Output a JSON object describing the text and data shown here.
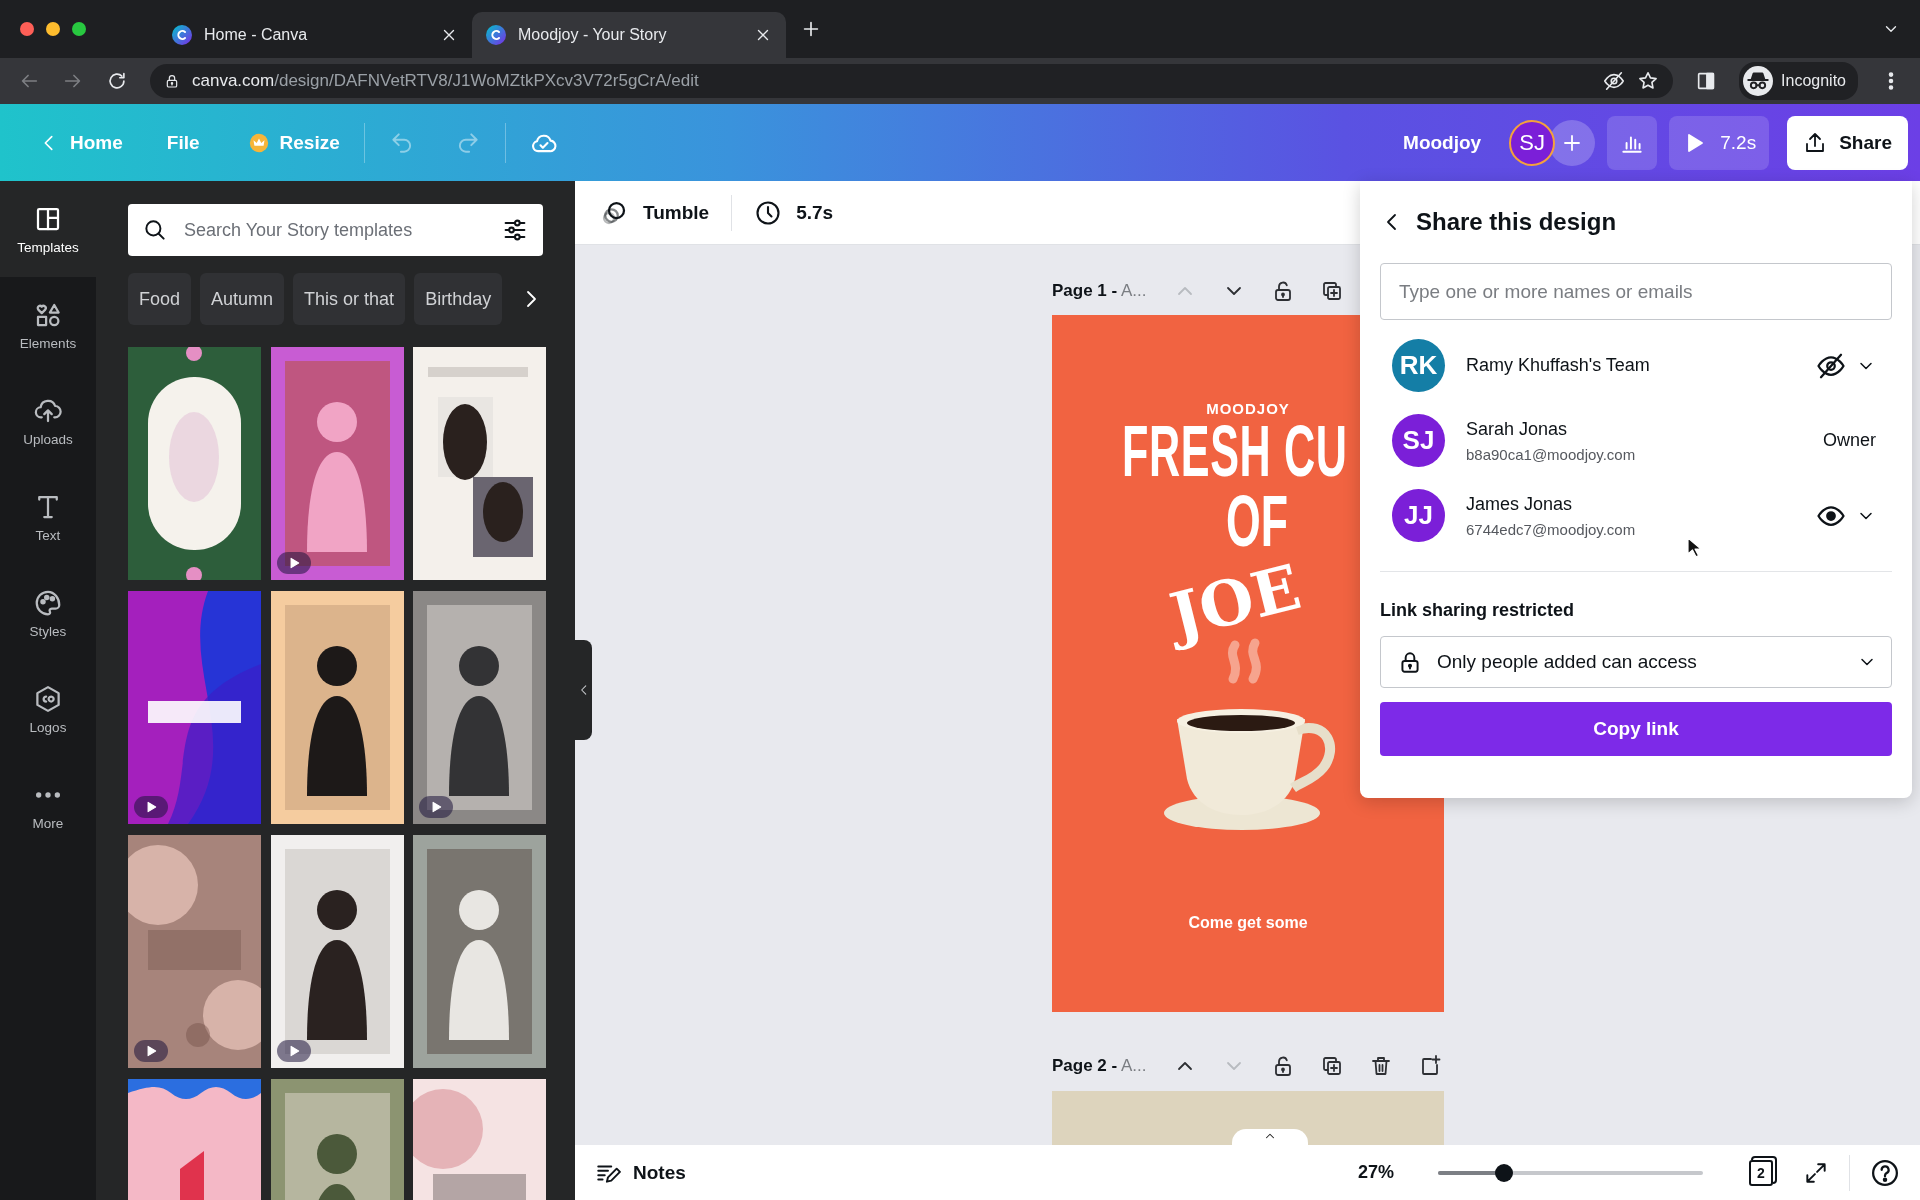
{
  "browser": {
    "tabs": [
      {
        "title": "Home - Canva",
        "selected": false
      },
      {
        "title": "Moodjoy - Your Story",
        "selected": true
      }
    ],
    "back_disabled": true,
    "forward_disabled": true,
    "url_host": "canva.com",
    "url_path": "/design/DAFNVetRTV8/J1WoMZtkPXcv3V72r5gCrA/edit",
    "profile": "Incognito"
  },
  "toolbar": {
    "home": "Home",
    "file": "File",
    "resize": "Resize",
    "undo_disabled": true,
    "redo_disabled": true,
    "design_name": "Moodjoy",
    "avatar": "SJ",
    "play_time": "7.2s",
    "share": "Share"
  },
  "rail": [
    {
      "label": "Templates",
      "selected": true
    },
    {
      "label": "Elements",
      "selected": false
    },
    {
      "label": "Uploads",
      "selected": false
    },
    {
      "label": "Text",
      "selected": false
    },
    {
      "label": "Styles",
      "selected": false
    },
    {
      "label": "Logos",
      "selected": false
    },
    {
      "label": "More",
      "selected": false
    }
  ],
  "templates_panel": {
    "search_placeholder": "Search Your Story templates",
    "chips": [
      "Food",
      "Autumn",
      "This or that",
      "Birthday"
    ],
    "templates": [
      {
        "kind": "picture",
        "video": false
      },
      {
        "kind": "picture",
        "video": true
      },
      {
        "kind": "picture",
        "video": false
      },
      {
        "kind": "picture",
        "video": true
      },
      {
        "kind": "picture",
        "video": false
      },
      {
        "kind": "picture",
        "video": true
      },
      {
        "kind": "picture",
        "video": true
      },
      {
        "kind": "picture",
        "video": true
      },
      {
        "kind": "picture",
        "video": false
      },
      {
        "kind": "picture",
        "video": false
      },
      {
        "kind": "picture",
        "video": false
      },
      {
        "kind": "picture",
        "video": false
      }
    ]
  },
  "subtoolbar": {
    "animation": "Tumble",
    "duration": "5.7s"
  },
  "pages": [
    {
      "label": "**Page 1 -** A...",
      "actions": [
        {
          "kind": "up",
          "disabled": true
        },
        {
          "kind": "down",
          "disabled": false
        },
        {
          "kind": "lock",
          "disabled": false
        },
        {
          "kind": "duplicate",
          "disabled": false
        }
      ]
    },
    {
      "label": "**Page 2 -** A...",
      "actions": [
        {
          "kind": "up",
          "disabled": false
        },
        {
          "kind": "down",
          "disabled": true
        },
        {
          "kind": "lock",
          "disabled": false
        },
        {
          "kind": "duplicate",
          "disabled": false
        },
        {
          "kind": "delete",
          "disabled": false
        },
        {
          "kind": "add",
          "disabled": false
        }
      ]
    }
  ],
  "design": {
    "brand": "MOODJOY",
    "headline": "FRESH CU",
    "headline_2": "OF",
    "headline_3": "JOE",
    "tagline": "Come get some"
  },
  "bottom_bar": {
    "notes": "Notes",
    "zoom": "27%",
    "zoom_slider": {
      "level": 0.25
    },
    "page_count": "2"
  },
  "share_panel": {
    "title": "Share this design",
    "input_placeholder": "Type one or more names or emails",
    "members": [
      {
        "initials": "RK",
        "name": "Ramy Khuffash's Team",
        "color": "#147ea6",
        "kind": "menu",
        "can_view": false
      },
      {
        "initials": "SJ",
        "name": "Sarah Jonas",
        "email": "b8a90ca1@moodjoy.com",
        "color": "#7b1fd8",
        "kind": "role",
        "role": "Owner"
      },
      {
        "initials": "JJ",
        "name": "James Jonas",
        "email": "6744edc7@moodjoy.com",
        "color": "#7b1fd8",
        "kind": "menu",
        "can_view": true
      }
    ],
    "link_heading": "Link sharing restricted",
    "link_access": "Only people added can access",
    "copy_button": "Copy link"
  }
}
